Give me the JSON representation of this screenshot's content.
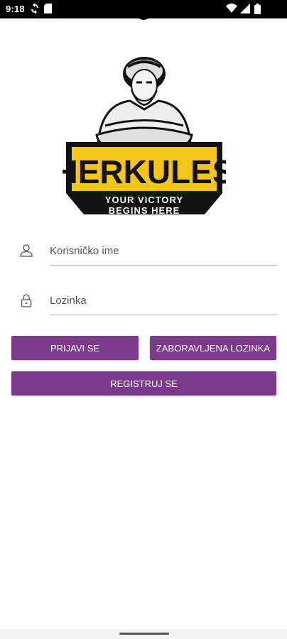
{
  "status_bar": {
    "time": "9:18"
  },
  "icons": {
    "status_left": [
      "sync-icon",
      "sd-card-icon"
    ],
    "status_right": [
      "wifi-icon",
      "signal-icon",
      "battery-icon"
    ],
    "username": "person-icon",
    "password": "lock-icon"
  },
  "logo": {
    "name": "HERKULES",
    "tagline_line1": "YOUR VICTORY",
    "tagline_line2": "BEGINS HERE"
  },
  "form": {
    "username_placeholder": "Korisničko ime",
    "password_placeholder": "Lozinka"
  },
  "buttons": {
    "login": "PRIJAVI SE",
    "forgot_password": "ZABORAVLJENA LOZINKA",
    "register": "REGISTRUJ SE"
  },
  "colors": {
    "primary": "#7b3a8c",
    "logo_yellow": "#f5c518",
    "status_bar": "#000000"
  }
}
